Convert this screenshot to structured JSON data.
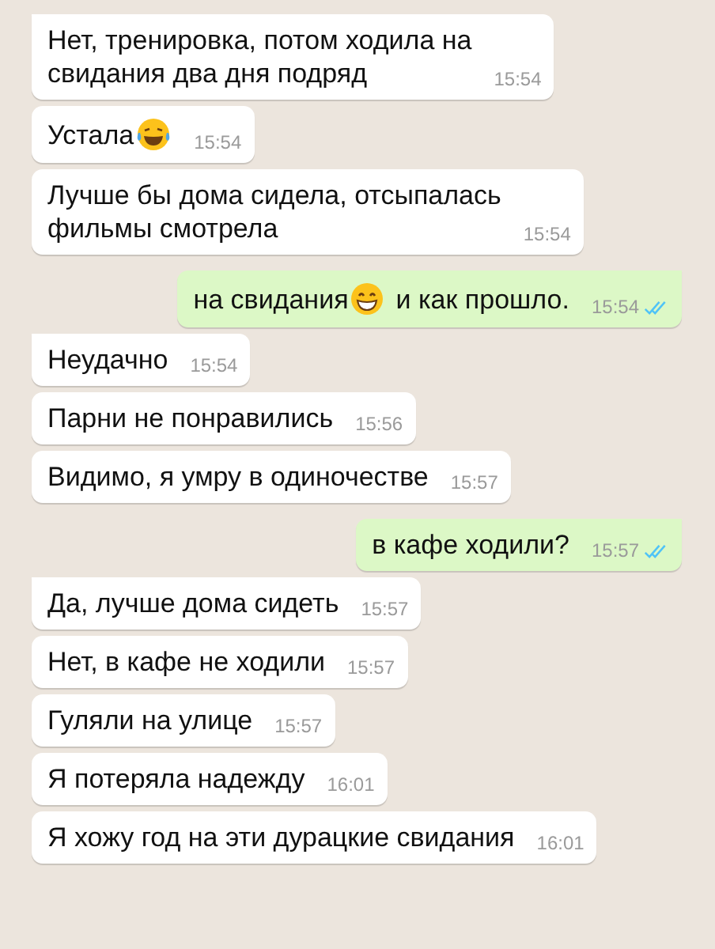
{
  "messages": [
    {
      "kind": "in",
      "tail": true,
      "parts": [
        {
          "kind": "text",
          "text": "Нет, тренировка, потом ходила на\nсвидания два дня подряд"
        }
      ],
      "time": "15:54"
    },
    {
      "kind": "in",
      "tail": false,
      "parts": [
        {
          "kind": "text",
          "text": "Устала"
        },
        {
          "kind": "laughing"
        }
      ],
      "time": "15:54"
    },
    {
      "kind": "in",
      "tail": false,
      "parts": [
        {
          "kind": "text",
          "text": "Лучше бы дома сидела, отсыпалась\nфильмы смотрела"
        }
      ],
      "time": "15:54"
    },
    {
      "kind": "out",
      "tail": true,
      "read": true,
      "parts": [
        {
          "kind": "text",
          "text": "на свидания"
        },
        {
          "kind": "grinning"
        },
        {
          "kind": "text",
          "text": "и как прошло."
        }
      ],
      "time": "15:54"
    },
    {
      "kind": "in",
      "tail": true,
      "parts": [
        {
          "kind": "text",
          "text": "Неудачно"
        }
      ],
      "time": "15:54"
    },
    {
      "kind": "in",
      "tail": false,
      "parts": [
        {
          "kind": "text",
          "text": "Парни не понравились"
        }
      ],
      "time": "15:56"
    },
    {
      "kind": "in",
      "tail": false,
      "parts": [
        {
          "kind": "text",
          "text": "Видимо, я умру в одиночестве"
        }
      ],
      "time": "15:57"
    },
    {
      "kind": "out",
      "tail": true,
      "read": true,
      "parts": [
        {
          "kind": "text",
          "text": "в кафе ходили?"
        }
      ],
      "time": "15:57"
    },
    {
      "kind": "in",
      "tail": true,
      "parts": [
        {
          "kind": "text",
          "text": "Да, лучше дома сидеть"
        }
      ],
      "time": "15:57"
    },
    {
      "kind": "in",
      "tail": false,
      "parts": [
        {
          "kind": "text",
          "text": "Нет, в кафе не ходили"
        }
      ],
      "time": "15:57"
    },
    {
      "kind": "in",
      "tail": false,
      "parts": [
        {
          "kind": "text",
          "text": "Гуляли на улице"
        }
      ],
      "time": "15:57"
    },
    {
      "kind": "in",
      "tail": false,
      "parts": [
        {
          "kind": "text",
          "text": "Я потеряла надежду"
        }
      ],
      "time": "16:01"
    },
    {
      "kind": "in",
      "tail": false,
      "parts": [
        {
          "kind": "text",
          "text": "Я хожу год на эти дурацкие свидания"
        }
      ],
      "time": "16:01"
    }
  ]
}
